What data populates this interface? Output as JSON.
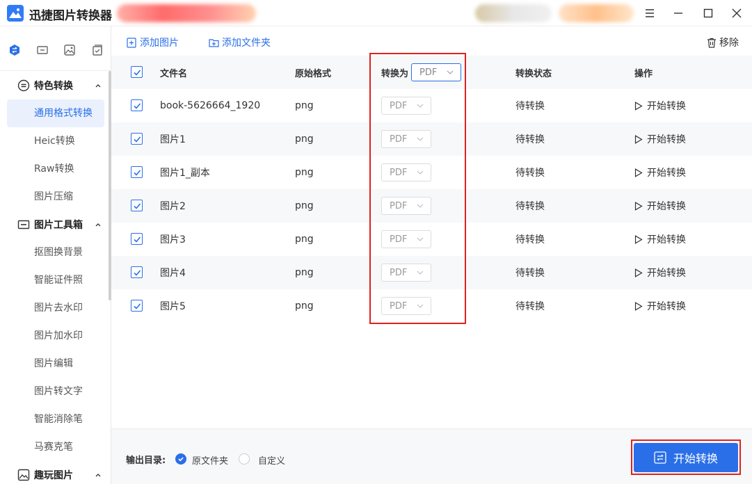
{
  "app": {
    "title": "迅捷图片转换器"
  },
  "toolbar": {
    "add_image": "添加图片",
    "add_folder": "添加文件夹",
    "remove": "移除"
  },
  "sidebar": {
    "sections": [
      {
        "label": "特色转换",
        "items": [
          "通用格式转换",
          "Heic转换",
          "Raw转换",
          "图片压缩"
        ]
      },
      {
        "label": "图片工具箱",
        "items": [
          "抠图换背景",
          "智能证件照",
          "图片去水印",
          "图片加水印",
          "图片编辑",
          "图片转文字",
          "智能消除笔",
          "马赛克笔"
        ]
      },
      {
        "label": "趣玩图片",
        "items": []
      }
    ],
    "active_item": "通用格式转换"
  },
  "table": {
    "headers": {
      "name": "文件名",
      "format": "原始格式",
      "convert_to": "转换为",
      "status": "转换状态",
      "action": "操作"
    },
    "header_format_value": "PDF",
    "rows": [
      {
        "name": "book-5626664_1920",
        "format": "png",
        "target": "PDF",
        "status": "待转换",
        "action": "开始转换"
      },
      {
        "name": "图片1",
        "format": "png",
        "target": "PDF",
        "status": "待转换",
        "action": "开始转换"
      },
      {
        "name": "图片1_副本",
        "format": "png",
        "target": "PDF",
        "status": "待转换",
        "action": "开始转换"
      },
      {
        "name": "图片2",
        "format": "png",
        "target": "PDF",
        "status": "待转换",
        "action": "开始转换"
      },
      {
        "name": "图片3",
        "format": "png",
        "target": "PDF",
        "status": "待转换",
        "action": "开始转换"
      },
      {
        "name": "图片4",
        "format": "png",
        "target": "PDF",
        "status": "待转换",
        "action": "开始转换"
      },
      {
        "name": "图片5",
        "format": "png",
        "target": "PDF",
        "status": "待转换",
        "action": "开始转换"
      }
    ]
  },
  "footer": {
    "output_label": "输出目录:",
    "option_original": "原文件夹",
    "option_custom": "自定义",
    "start_button": "开始转换"
  },
  "colors": {
    "accent": "#2a6fe8",
    "highlight": "#e02020"
  }
}
